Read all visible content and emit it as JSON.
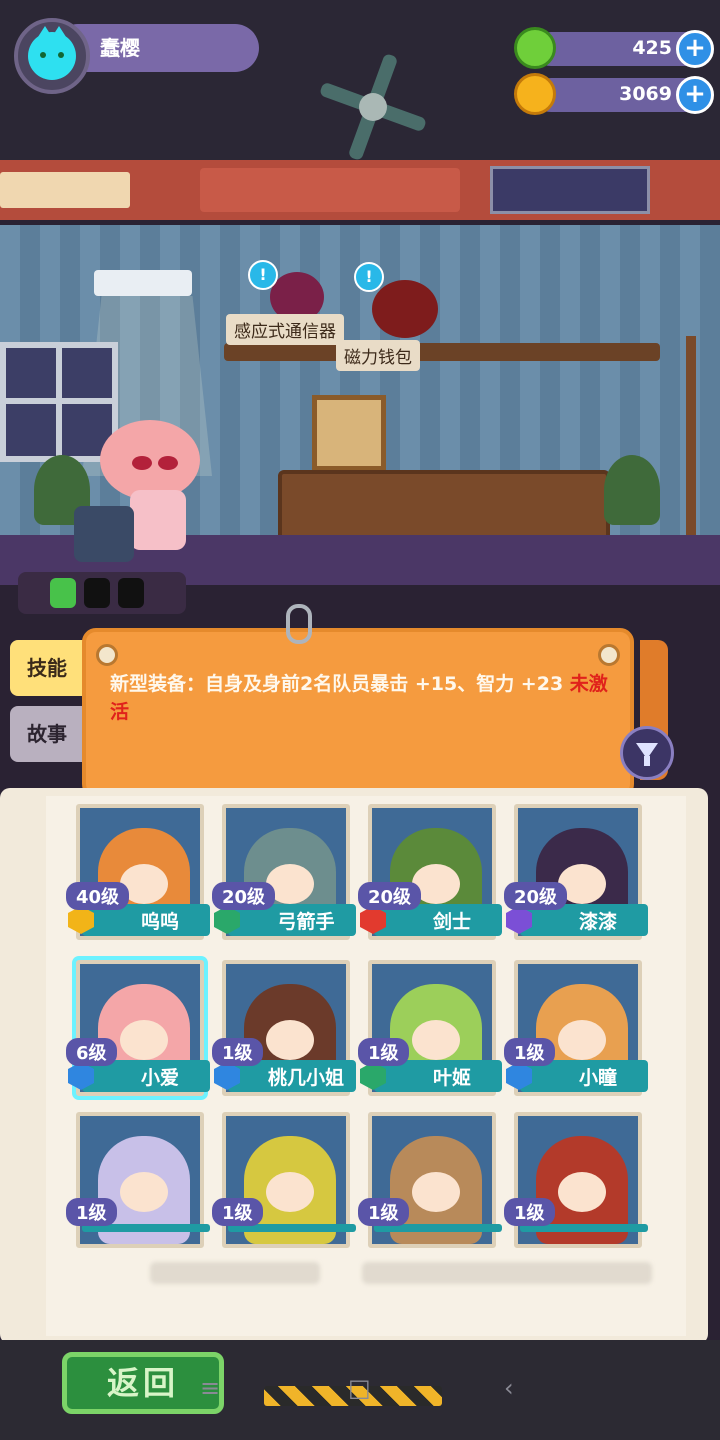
{
  "player": {
    "name": "蠢樱"
  },
  "currencies": [
    {
      "id": "gem",
      "value": "425",
      "icon": "green-gem-coin-icon",
      "color": "#6fcf3a"
    },
    {
      "id": "gold",
      "value": "3069",
      "icon": "planet-coin-icon",
      "color": "#f6b21c"
    }
  ],
  "room": {
    "items": [
      {
        "label": "感应式通信器",
        "icon": "radio-device-icon"
      },
      {
        "label": "磁力钱包",
        "icon": "wallet-bag-icon"
      }
    ]
  },
  "tabs": [
    {
      "label": "技能"
    },
    {
      "label": "故事"
    }
  ],
  "info_card": {
    "text": "新型装备：自身及身前2名队员暴击 +15、智力 +23",
    "status": "未激活"
  },
  "roster": [
    {
      "level": "40级",
      "name": "呜呜",
      "class_color": "#f2b418",
      "char_color": "#e88a3a"
    },
    {
      "level": "20级",
      "name": "弓箭手",
      "class_color": "#2aa86a",
      "char_color": "#6d8e8e"
    },
    {
      "level": "20级",
      "name": "剑士",
      "class_color": "#e23a2e",
      "char_color": "#5b8a3a"
    },
    {
      "level": "20级",
      "name": "漆漆",
      "class_color": "#7b4fd6",
      "char_color": "#3b2a4a"
    },
    {
      "level": "6级",
      "name": "小爱",
      "class_color": "#2f86e0",
      "char_color": "#f4a6a8",
      "selected": true
    },
    {
      "level": "1级",
      "name": "桃几小姐",
      "class_color": "#2f86e0",
      "char_color": "#6b3a2a"
    },
    {
      "level": "1级",
      "name": "叶姬",
      "class_color": "#2aa86a",
      "char_color": "#9ccf5a"
    },
    {
      "level": "1级",
      "name": "小瞳",
      "class_color": "#2f86e0",
      "char_color": "#e8a050"
    },
    {
      "level": "1级",
      "char_color": "#c8c0e8"
    },
    {
      "level": "1级",
      "char_color": "#d6c840"
    },
    {
      "level": "1级",
      "char_color": "#b88a5a"
    },
    {
      "level": "1级",
      "char_color": "#b33a2a"
    }
  ],
  "back_button": {
    "label": "返回"
  }
}
